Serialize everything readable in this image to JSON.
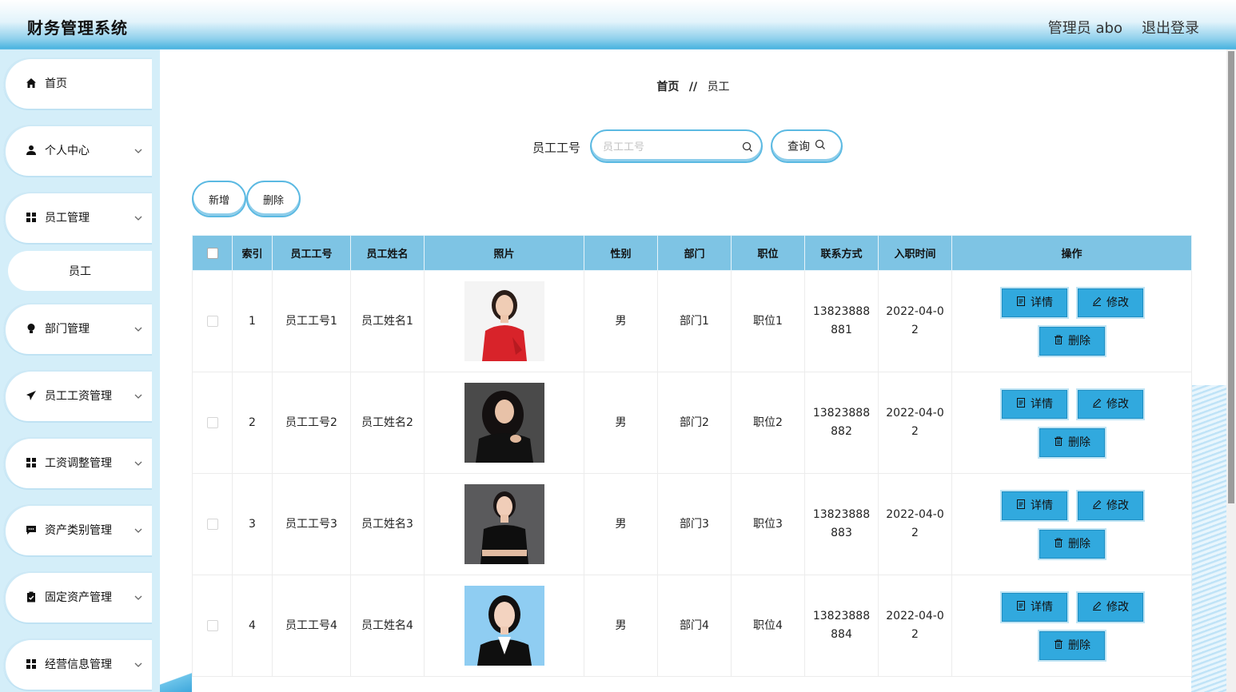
{
  "header": {
    "app_title": "财务管理系统",
    "user_label": "管理员 abo",
    "logout_label": "退出登录"
  },
  "sidebar": {
    "items": [
      {
        "label": "首页",
        "icon": "home-icon"
      },
      {
        "label": "个人中心",
        "icon": "user-icon"
      },
      {
        "label": "员工管理",
        "icon": "grid-icon"
      },
      {
        "label": "部门管理",
        "icon": "bulb-icon"
      },
      {
        "label": "员工工资管理",
        "icon": "send-icon"
      },
      {
        "label": "工资调整管理",
        "icon": "grid-icon"
      },
      {
        "label": "资产类别管理",
        "icon": "chat-icon"
      },
      {
        "label": "固定资产管理",
        "icon": "clipboard-icon"
      },
      {
        "label": "经营信息管理",
        "icon": "grid-icon"
      }
    ],
    "sub_item": "员工"
  },
  "breadcrumb": {
    "home": "首页",
    "separator": "//",
    "current": "员工"
  },
  "search": {
    "label": "员工工号",
    "placeholder": "员工工号",
    "value": "",
    "query_label": "查询"
  },
  "toolbar": {
    "add_label": "新增",
    "delete_label": "删除"
  },
  "table": {
    "headers": [
      "索引",
      "员工工号",
      "员工姓名",
      "照片",
      "性别",
      "部门",
      "职位",
      "联系方式",
      "入职时间",
      "操作"
    ],
    "actions": {
      "detail": "详情",
      "edit": "修改",
      "delete": "删除"
    },
    "rows": [
      {
        "index": "1",
        "emp_no": "员工工号1",
        "name": "员工姓名1",
        "photo": "portrait-red-jacket",
        "gender": "男",
        "dept": "部门1",
        "position": "职位1",
        "phone_a": "13823888",
        "phone_b": "881",
        "date_a": "2022-04-0",
        "date_b": "2"
      },
      {
        "index": "2",
        "emp_no": "员工工号2",
        "name": "员工姓名2",
        "photo": "portrait-curly-hair",
        "gender": "男",
        "dept": "部门2",
        "position": "职位2",
        "phone_a": "13823888",
        "phone_b": "882",
        "date_a": "2022-04-0",
        "date_b": "2"
      },
      {
        "index": "3",
        "emp_no": "员工工号3",
        "name": "员工姓名3",
        "photo": "portrait-black-dress",
        "gender": "男",
        "dept": "部门3",
        "position": "职位3",
        "phone_a": "13823888",
        "phone_b": "883",
        "date_a": "2022-04-0",
        "date_b": "2"
      },
      {
        "index": "4",
        "emp_no": "员工工号4",
        "name": "员工姓名4",
        "photo": "portrait-blue-background",
        "gender": "男",
        "dept": "部门4",
        "position": "职位4",
        "phone_a": "13823888",
        "phone_b": "884",
        "date_a": "2022-04-0",
        "date_b": "2"
      }
    ]
  },
  "colors": {
    "header_blue": "#49b3e0",
    "table_header": "#7ec4e4",
    "action_button": "#31a9de",
    "sidebar_bg": "#d4eef9"
  }
}
